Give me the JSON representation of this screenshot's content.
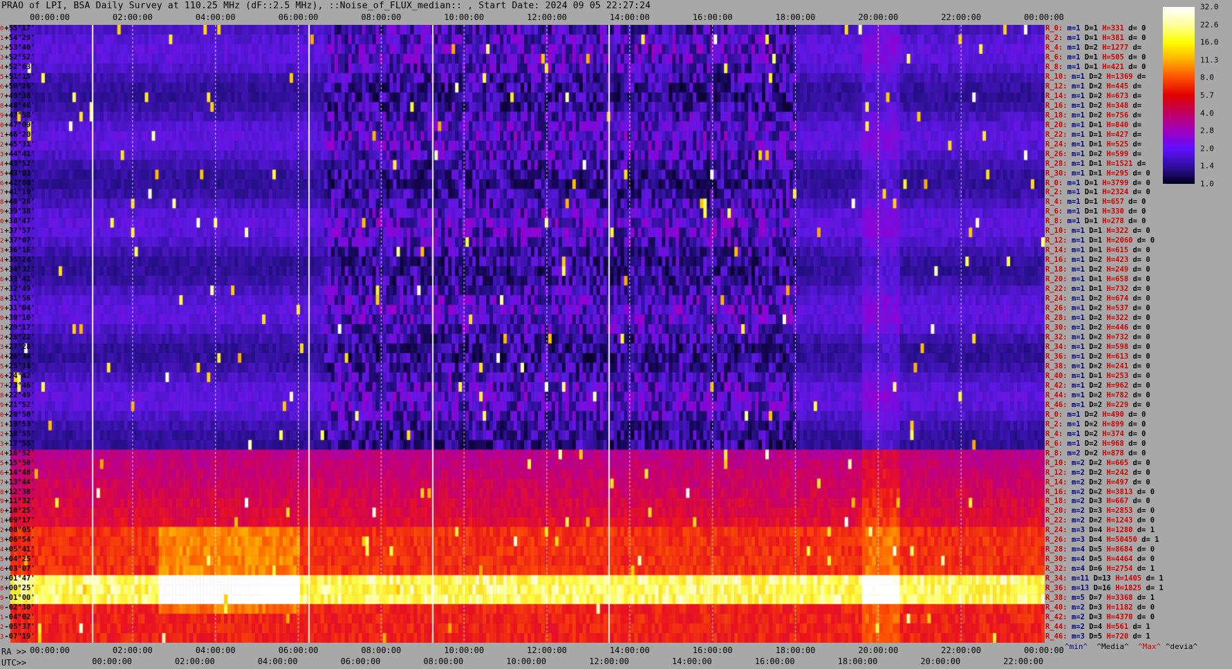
{
  "chart_data": {
    "type": "heatmap",
    "title": "PRAO of LPI, BSA Daily Survey at 110.25 MHz (dF::2.5 MHz), ::Noise_of_FLUX_median:: , Start Date: 2024 09 05 22:27:24",
    "top_axis_labels": [
      "00:00:00",
      "02:00:00",
      "04:00:00",
      "06:00:00",
      "08:00:00",
      "10:00:00",
      "12:00:00",
      "14:00:00",
      "16:00:00",
      "18:00:00",
      "20:00:00",
      "22:00:00",
      "00:00:00"
    ],
    "bottom_axis": {
      "ra_prefix": "RA >>",
      "ra_labels": [
        "00:00:00",
        "02:00:00",
        "04:00:00",
        "06:00:00",
        "08:00:00",
        "10:00:00",
        "12:00:00",
        "14:00:00",
        "16:00:00",
        "18:00:00",
        "20:00:00",
        "22:00:00",
        "00:00:00"
      ],
      "utc_prefix": "UTC>>",
      "utc_labels": [
        "00:00:00",
        "02:00:00",
        "04:00:00",
        "06:00:00",
        "08:00:00",
        "10:00:00",
        "12:00:00",
        "14:00:00",
        "16:00:00",
        "18:00:00",
        "20:00:00",
        "22:00:00"
      ]
    },
    "declinations": [
      "+55°17'",
      "+54°29'",
      "+53°40'",
      "+52°52'",
      "+52°03'",
      "+51°15'",
      "+50°26'",
      "+49°38'",
      "+48°46'",
      "+47°58'",
      "+47°09'",
      "+46°20'",
      "+45°31'",
      "+44°41'",
      "+43°52'",
      "+43°03'",
      "+42°08'",
      "+41°19'",
      "+40°28'",
      "+39°38'",
      "+38°47'",
      "+37°57'",
      "+37°07'",
      "+36°16'",
      "+35°24'",
      "+34°32'",
      "+33°41'",
      "+32°49'",
      "+31°56'",
      "+31°04'",
      "+30°10'",
      "+29°17'",
      "+28°22'",
      "+27°28'",
      "+26°34'",
      "+25°38'",
      "+24°42'",
      "+23°46'",
      "+22°49'",
      "+21°52'",
      "+20°50'",
      "+19°53'",
      "+18°55'",
      "+17°55'",
      "+16°52'",
      "+15°50'",
      "+14°48'",
      "+13°44'",
      "+12°38'",
      "+11°32'",
      "+10°25'",
      "+09°17'",
      "+08°05'",
      "+06°54'",
      "+05°41'",
      "+04°25'",
      "+03°07'",
      "+01°47'",
      "+00°25'",
      "-01°00'",
      "-02°30'",
      "-04°02'",
      "-05°37'",
      "-07°19'"
    ],
    "stats": [
      {
        "r": "R_0:",
        "m": "m=1",
        "d": "D=1",
        "h": "H=331",
        "dv": "d= 0"
      },
      {
        "r": "R_2:",
        "m": "m=1",
        "d": "D=1",
        "h": "H=381",
        "dv": "d= 0"
      },
      {
        "r": "R_4:",
        "m": "m=1",
        "d": "D=2",
        "h": "H=1277",
        "dv": "d="
      },
      {
        "r": "R_6:",
        "m": "m=1",
        "d": "D=1",
        "h": "H=505",
        "dv": "d= 0"
      },
      {
        "r": "R_8:",
        "m": "m=1",
        "d": "D=1",
        "h": "H=421",
        "dv": "d= 0"
      },
      {
        "r": "R_10:",
        "m": "m=1",
        "d": "D=2",
        "h": "H=1369",
        "dv": "d="
      },
      {
        "r": "R_12:",
        "m": "m=1",
        "d": "D=2",
        "h": "H=445",
        "dv": "d="
      },
      {
        "r": "R_14:",
        "m": "m=1",
        "d": "D=2",
        "h": "H=673",
        "dv": "d="
      },
      {
        "r": "R_16:",
        "m": "m=1",
        "d": "D=2",
        "h": "H=348",
        "dv": "d="
      },
      {
        "r": "R_18:",
        "m": "m=1",
        "d": "D=2",
        "h": "H=756",
        "dv": "d="
      },
      {
        "r": "R_20:",
        "m": "m=1",
        "d": "D=1",
        "h": "H=840",
        "dv": "d="
      },
      {
        "r": "R_22:",
        "m": "m=1",
        "d": "D=1",
        "h": "H=427",
        "dv": "d="
      },
      {
        "r": "R_24:",
        "m": "m=1",
        "d": "D=1",
        "h": "H=525",
        "dv": "d="
      },
      {
        "r": "R_26:",
        "m": "m=1",
        "d": "D=2",
        "h": "H=599",
        "dv": "d="
      },
      {
        "r": "R_28:",
        "m": "m=1",
        "d": "D=1",
        "h": "H=1521",
        "dv": "d="
      },
      {
        "r": "R_30:",
        "m": "m=1",
        "d": "D=1",
        "h": "H=295",
        "dv": "d= 0"
      },
      {
        "r": "R_0:",
        "m": "m=1",
        "d": "D=1",
        "h": "H=3799",
        "dv": "d= 0"
      },
      {
        "r": "R_2:",
        "m": "m=1",
        "d": "D=1",
        "h": "H=2324",
        "dv": "d= 0"
      },
      {
        "r": "R_4:",
        "m": "m=1",
        "d": "D=1",
        "h": "H=657",
        "dv": "d= 0"
      },
      {
        "r": "R_6:",
        "m": "m=1",
        "d": "D=1",
        "h": "H=330",
        "dv": "d= 0"
      },
      {
        "r": "R_8:",
        "m": "m=1",
        "d": "D=1",
        "h": "H=278",
        "dv": "d= 0"
      },
      {
        "r": "R_10:",
        "m": "m=1",
        "d": "D=1",
        "h": "H=322",
        "dv": "d= 0"
      },
      {
        "r": "R_12:",
        "m": "m=1",
        "d": "D=1",
        "h": "H=2060",
        "dv": "d= 0"
      },
      {
        "r": "R_14:",
        "m": "m=1",
        "d": "D=1",
        "h": "H=615",
        "dv": "d= 0"
      },
      {
        "r": "R_16:",
        "m": "m=1",
        "d": "D=2",
        "h": "H=423",
        "dv": "d= 0"
      },
      {
        "r": "R_18:",
        "m": "m=1",
        "d": "D=2",
        "h": "H=249",
        "dv": "d= 0"
      },
      {
        "r": "R_20:",
        "m": "m=1",
        "d": "D=1",
        "h": "H=658",
        "dv": "d= 0"
      },
      {
        "r": "R_22:",
        "m": "m=1",
        "d": "D=1",
        "h": "H=732",
        "dv": "d= 0"
      },
      {
        "r": "R_24:",
        "m": "m=1",
        "d": "D=2",
        "h": "H=674",
        "dv": "d= 0"
      },
      {
        "r": "R_26:",
        "m": "m=1",
        "d": "D=2",
        "h": "H=537",
        "dv": "d= 0"
      },
      {
        "r": "R_28:",
        "m": "m=1",
        "d": "D=2",
        "h": "H=322",
        "dv": "d= 0"
      },
      {
        "r": "R_30:",
        "m": "m=1",
        "d": "D=2",
        "h": "H=446",
        "dv": "d= 0"
      },
      {
        "r": "R_32:",
        "m": "m=1",
        "d": "D=2",
        "h": "H=732",
        "dv": "d= 0"
      },
      {
        "r": "R_34:",
        "m": "m=1",
        "d": "D=2",
        "h": "H=598",
        "dv": "d= 0"
      },
      {
        "r": "R_36:",
        "m": "m=1",
        "d": "D=2",
        "h": "H=613",
        "dv": "d= 0"
      },
      {
        "r": "R_38:",
        "m": "m=1",
        "d": "D=2",
        "h": "H=241",
        "dv": "d= 0"
      },
      {
        "r": "R_40:",
        "m": "m=1",
        "d": "D=1",
        "h": "H=253",
        "dv": "d= 0"
      },
      {
        "r": "R_42:",
        "m": "m=1",
        "d": "D=2",
        "h": "H=962",
        "dv": "d= 0"
      },
      {
        "r": "R_44:",
        "m": "m=1",
        "d": "D=2",
        "h": "H=782",
        "dv": "d= 0"
      },
      {
        "r": "R_46:",
        "m": "m=1",
        "d": "D=2",
        "h": "H=229",
        "dv": "d= 0"
      },
      {
        "r": "R_0:",
        "m": "m=1",
        "d": "D=2",
        "h": "H=490",
        "dv": "d= 0"
      },
      {
        "r": "R_2:",
        "m": "m=1",
        "d": "D=2",
        "h": "H=899",
        "dv": "d= 0"
      },
      {
        "r": "R_4:",
        "m": "m=1",
        "d": "D=2",
        "h": "H=374",
        "dv": "d= 0"
      },
      {
        "r": "R_6:",
        "m": "m=1",
        "d": "D=2",
        "h": "H=968",
        "dv": "d= 0"
      },
      {
        "r": "R_8:",
        "m": "m=2",
        "d": "D=2",
        "h": "H=878",
        "dv": "d= 0"
      },
      {
        "r": "R_10:",
        "m": "m=2",
        "d": "D=2",
        "h": "H=665",
        "dv": "d= 0"
      },
      {
        "r": "R_12:",
        "m": "m=2",
        "d": "D=2",
        "h": "H=242",
        "dv": "d= 0"
      },
      {
        "r": "R_14:",
        "m": "m=2",
        "d": "D=2",
        "h": "H=497",
        "dv": "d= 0"
      },
      {
        "r": "R_16:",
        "m": "m=2",
        "d": "D=2",
        "h": "H=3813",
        "dv": "d= 0"
      },
      {
        "r": "R_18:",
        "m": "m=2",
        "d": "D=3",
        "h": "H=667",
        "dv": "d= 0"
      },
      {
        "r": "R_20:",
        "m": "m=2",
        "d": "D=3",
        "h": "H=2853",
        "dv": "d= 0"
      },
      {
        "r": "R_22:",
        "m": "m=2",
        "d": "D=2",
        "h": "H=1243",
        "dv": "d= 0"
      },
      {
        "r": "R_24:",
        "m": "m=3",
        "d": "D=4",
        "h": "H=1280",
        "dv": "d= 1"
      },
      {
        "r": "R_26:",
        "m": "m=3",
        "d": "D=4",
        "h": "H=50450",
        "dv": "d= 1"
      },
      {
        "r": "R_28:",
        "m": "m=4",
        "d": "D=5",
        "h": "H=8684",
        "dv": "d= 0"
      },
      {
        "r": "R_30:",
        "m": "m=4",
        "d": "D=5",
        "h": "H=4464",
        "dv": "d= 0"
      },
      {
        "r": "R_32:",
        "m": "m=4",
        "d": "D=6",
        "h": "H=2754",
        "dv": "d= 1"
      },
      {
        "r": "R_34:",
        "m": "m=11",
        "d": "D=13",
        "h": "H=1405",
        "dv": "d= 1"
      },
      {
        "r": "R_36:",
        "m": "m=13",
        "d": "D=16",
        "h": "H=1825",
        "dv": "d= 1"
      },
      {
        "r": "R_38:",
        "m": "m=5",
        "d": "D=7",
        "h": "H=3368",
        "dv": "d= 1"
      },
      {
        "r": "R_40:",
        "m": "m=2",
        "d": "D=3",
        "h": "H=1182",
        "dv": "d= 0"
      },
      {
        "r": "R_42:",
        "m": "m=2",
        "d": "D=3",
        "h": "H=4370",
        "dv": "d= 0"
      },
      {
        "r": "R_44:",
        "m": "m=2",
        "d": "D=4",
        "h": "H=561",
        "dv": "d= 1"
      },
      {
        "r": "R_46:",
        "m": "m=3",
        "d": "D=5",
        "h": "H=720",
        "dv": "d= 1"
      }
    ],
    "colorbar": {
      "ticks": [
        "32.0",
        "22.6",
        "16.0",
        "11.3",
        "8.0",
        "5.7",
        "4.0",
        "2.8",
        "2.0",
        "1.4",
        "1.0"
      ],
      "colors": [
        "#ffffff",
        "#ffffa0",
        "#ffff00",
        "#ffb000",
        "#ff5000",
        "#e00000",
        "#c00060",
        "#a000c0",
        "#6010ff",
        "#3010a0",
        "#000020"
      ]
    },
    "legend": {
      "min": "^min^",
      "median": "^Media^",
      "max": "^Max^",
      "devia": "^devia^"
    }
  }
}
